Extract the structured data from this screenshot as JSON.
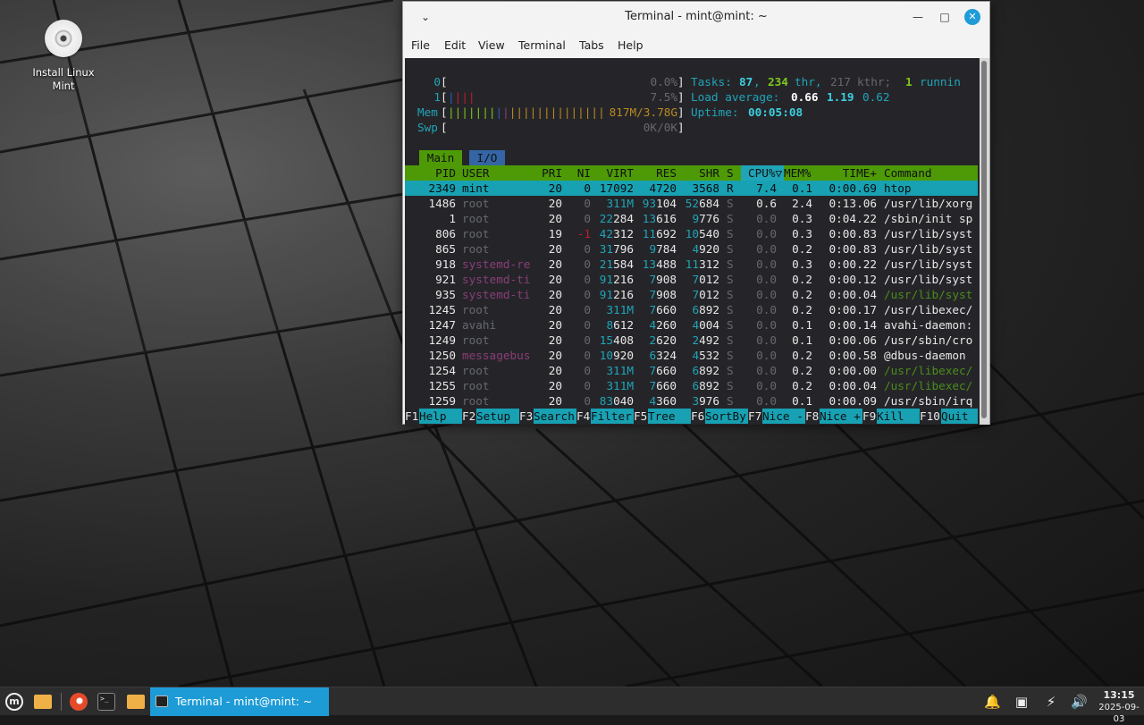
{
  "desktop": {
    "icon_label_line1": "Install Linux",
    "icon_label_line2": "Mint"
  },
  "window": {
    "title": "Terminal - mint@mint: ~",
    "menu": [
      "File",
      "Edit",
      "View",
      "Terminal",
      "Tabs",
      "Help"
    ]
  },
  "htop": {
    "cpu0_label": "0",
    "cpu0_pct": "0.0%",
    "cpu1_label": "1",
    "cpu1_pct": "7.5%",
    "mem_label": "Mem",
    "mem_value": "817M/3.78G",
    "swp_label": "Swp",
    "swp_value": "0K/0K",
    "tasks_label": "Tasks:",
    "tasks": "87",
    "threads": "234",
    "thr_label": "thr,",
    "kthreads": "217",
    "kthr_label": "kthr;",
    "running": "1",
    "running_label": "runnin",
    "load_label": "Load average:",
    "load1": "0.66",
    "load5": "1.19",
    "load15": "0.62",
    "uptime_label": "Uptime:",
    "uptime": "00:05:08",
    "tab_main": "Main",
    "tab_io": "I/O",
    "columns": [
      "PID",
      "USER",
      "PRI",
      "NI",
      "VIRT",
      "RES",
      "SHR",
      "S",
      "CPU%▽",
      "MEM%",
      "TIME+",
      "Command"
    ],
    "processes": [
      {
        "pid": "2349",
        "user": "mint",
        "pri": "20",
        "ni": "0",
        "virt": "17092",
        "res": "4720",
        "shr": "3568",
        "s": "R",
        "cpu": "7.4",
        "mem": "0.1",
        "time": "0:00.69",
        "cmd": "htop"
      },
      {
        "pid": "1486",
        "user": "root",
        "pri": "20",
        "ni": "0",
        "virt": "311M",
        "res": "93104",
        "shr": "52684",
        "s": "S",
        "cpu": "0.6",
        "mem": "2.4",
        "time": "0:13.06",
        "cmd": "/usr/lib/xorg"
      },
      {
        "pid": "1",
        "user": "root",
        "pri": "20",
        "ni": "0",
        "virt": "22284",
        "res": "13616",
        "shr": "9776",
        "s": "S",
        "cpu": "0.0",
        "mem": "0.3",
        "time": "0:04.22",
        "cmd": "/sbin/init sp"
      },
      {
        "pid": "806",
        "user": "root",
        "pri": "19",
        "ni": "-1",
        "virt": "42312",
        "res": "11692",
        "shr": "10540",
        "s": "S",
        "cpu": "0.0",
        "mem": "0.3",
        "time": "0:00.83",
        "cmd": "/usr/lib/syst"
      },
      {
        "pid": "865",
        "user": "root",
        "pri": "20",
        "ni": "0",
        "virt": "31796",
        "res": "9784",
        "shr": "4920",
        "s": "S",
        "cpu": "0.0",
        "mem": "0.2",
        "time": "0:00.83",
        "cmd": "/usr/lib/syst"
      },
      {
        "pid": "918",
        "user": "systemd-re",
        "pri": "20",
        "ni": "0",
        "virt": "21584",
        "res": "13488",
        "shr": "11312",
        "s": "S",
        "cpu": "0.0",
        "mem": "0.3",
        "time": "0:00.22",
        "cmd": "/usr/lib/syst"
      },
      {
        "pid": "921",
        "user": "systemd-ti",
        "pri": "20",
        "ni": "0",
        "virt": "91216",
        "res": "7908",
        "shr": "7012",
        "s": "S",
        "cpu": "0.0",
        "mem": "0.2",
        "time": "0:00.12",
        "cmd": "/usr/lib/syst"
      },
      {
        "pid": "935",
        "user": "systemd-ti",
        "pri": "20",
        "ni": "0",
        "virt": "91216",
        "res": "7908",
        "shr": "7012",
        "s": "S",
        "cpu": "0.0",
        "mem": "0.2",
        "time": "0:00.04",
        "cmd": "/usr/lib/syst"
      },
      {
        "pid": "1245",
        "user": "root",
        "pri": "20",
        "ni": "0",
        "virt": "311M",
        "res": "7660",
        "shr": "6892",
        "s": "S",
        "cpu": "0.0",
        "mem": "0.2",
        "time": "0:00.17",
        "cmd": "/usr/libexec/"
      },
      {
        "pid": "1247",
        "user": "avahi",
        "pri": "20",
        "ni": "0",
        "virt": "8612",
        "res": "4260",
        "shr": "4004",
        "s": "S",
        "cpu": "0.0",
        "mem": "0.1",
        "time": "0:00.14",
        "cmd": "avahi-daemon:"
      },
      {
        "pid": "1249",
        "user": "root",
        "pri": "20",
        "ni": "0",
        "virt": "15408",
        "res": "2620",
        "shr": "2492",
        "s": "S",
        "cpu": "0.0",
        "mem": "0.1",
        "time": "0:00.06",
        "cmd": "/usr/sbin/cro"
      },
      {
        "pid": "1250",
        "user": "messagebus",
        "pri": "20",
        "ni": "0",
        "virt": "10920",
        "res": "6324",
        "shr": "4532",
        "s": "S",
        "cpu": "0.0",
        "mem": "0.2",
        "time": "0:00.58",
        "cmd": "@dbus-daemon"
      },
      {
        "pid": "1254",
        "user": "root",
        "pri": "20",
        "ni": "0",
        "virt": "311M",
        "res": "7660",
        "shr": "6892",
        "s": "S",
        "cpu": "0.0",
        "mem": "0.2",
        "time": "0:00.00",
        "cmd": "/usr/libexec/"
      },
      {
        "pid": "1255",
        "user": "root",
        "pri": "20",
        "ni": "0",
        "virt": "311M",
        "res": "7660",
        "shr": "6892",
        "s": "S",
        "cpu": "0.0",
        "mem": "0.2",
        "time": "0:00.04",
        "cmd": "/usr/libexec/"
      },
      {
        "pid": "1259",
        "user": "root",
        "pri": "20",
        "ni": "0",
        "virt": "83040",
        "res": "4360",
        "shr": "3976",
        "s": "S",
        "cpu": "0.0",
        "mem": "0.1",
        "time": "0:00.09",
        "cmd": "/usr/sbin/irq"
      }
    ],
    "fkeys": [
      {
        "key": "F1",
        "label": "Help"
      },
      {
        "key": "F2",
        "label": "Setup"
      },
      {
        "key": "F3",
        "label": "Search"
      },
      {
        "key": "F4",
        "label": "Filter"
      },
      {
        "key": "F5",
        "label": "Tree"
      },
      {
        "key": "F6",
        "label": "SortBy"
      },
      {
        "key": "F7",
        "label": "Nice -"
      },
      {
        "key": "F8",
        "label": "Nice +"
      },
      {
        "key": "F9",
        "label": "Kill"
      },
      {
        "key": "F10",
        "label": "Quit"
      }
    ]
  },
  "taskbar": {
    "active_task": "Terminal - mint@mint: ~",
    "time": "13:15",
    "date": "2025-09-03",
    "icons": [
      "mint-menu-icon",
      "files-icon",
      "firefox-icon",
      "terminal-icon",
      "folder-icon",
      "notifications-icon",
      "display-icon",
      "power-icon",
      "volume-icon"
    ]
  }
}
